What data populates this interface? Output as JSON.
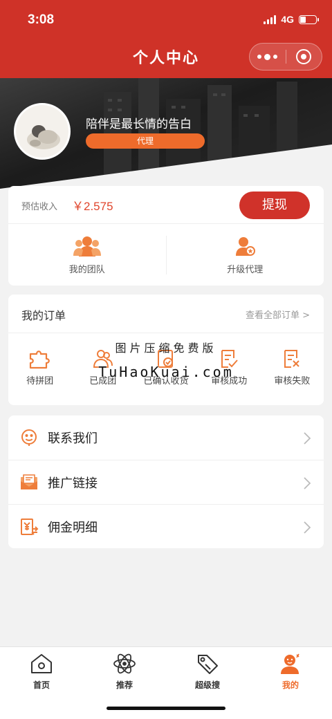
{
  "status_bar": {
    "time": "3:08",
    "network": "4G"
  },
  "nav": {
    "title": "个人中心",
    "menu_icon": "more-dots-icon",
    "close_icon": "target-icon"
  },
  "profile": {
    "nickname": "陪伴是最长情的告白",
    "role": "代理"
  },
  "earnings": {
    "label": "预估收入",
    "amount": "￥2.575",
    "withdraw_label": "提现"
  },
  "team": {
    "items": [
      {
        "label": "我的团队",
        "icon": "team-icon"
      },
      {
        "label": "升级代理",
        "icon": "agent-upgrade-icon"
      }
    ]
  },
  "orders": {
    "title": "我的订单",
    "view_all": "查看全部订单 >",
    "items": [
      {
        "label": "待拼团",
        "icon": "puzzle-icon"
      },
      {
        "label": "已成团",
        "icon": "group-icon"
      },
      {
        "label": "已确认收货",
        "icon": "received-icon"
      },
      {
        "label": "审核成功",
        "icon": "review-pass-icon"
      },
      {
        "label": "审核失败",
        "icon": "review-fail-icon"
      }
    ]
  },
  "watermark": {
    "line1": "图片压缩免费版",
    "line2": "TuHaoKuai.com"
  },
  "menu": {
    "items": [
      {
        "label": "联系我们",
        "icon": "customer-service-icon"
      },
      {
        "label": "推广链接",
        "icon": "promotion-envelope-icon"
      },
      {
        "label": "佣金明细",
        "icon": "commission-icon"
      }
    ]
  },
  "tabbar": {
    "items": [
      {
        "label": "首页",
        "icon": "home-icon",
        "active": false
      },
      {
        "label": "推荐",
        "icon": "atom-icon",
        "active": false
      },
      {
        "label": "超级搜",
        "icon": "tag-icon",
        "active": false
      },
      {
        "label": "我的",
        "icon": "profile-icon",
        "active": true
      }
    ]
  },
  "colors": {
    "primary_red": "#cf3228",
    "accent_orange": "#ee6b2b",
    "amount_red": "#e0462d"
  }
}
